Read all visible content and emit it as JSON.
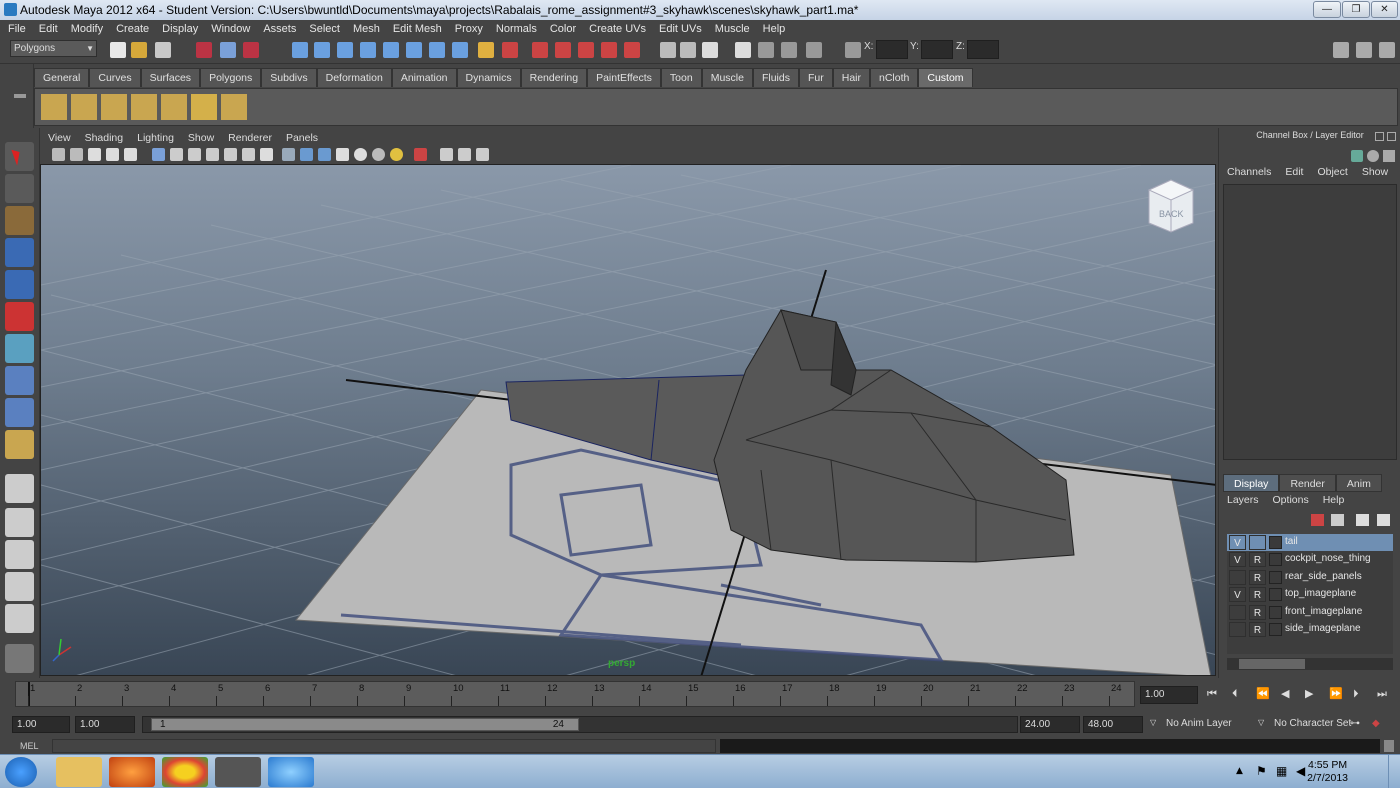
{
  "window": {
    "title": "Autodesk Maya 2012 x64 - Student Version: C:\\Users\\bwuntld\\Documents\\maya\\projects\\Rabalais_rome_assignment#3_skyhawk\\scenes\\skyhawk_part1.ma*",
    "minimize": "—",
    "maximize": "❐",
    "close": "✕"
  },
  "menubar": [
    "File",
    "Edit",
    "Modify",
    "Create",
    "Display",
    "Window",
    "Assets",
    "Select",
    "Mesh",
    "Edit Mesh",
    "Proxy",
    "Normals",
    "Color",
    "Create UVs",
    "Edit UVs",
    "Muscle",
    "Help"
  ],
  "statusline": {
    "menuset": "Polygons",
    "x_label": "X:",
    "y_label": "Y:",
    "z_label": "Z:"
  },
  "shelf": {
    "tabs": [
      "General",
      "Curves",
      "Surfaces",
      "Polygons",
      "Subdivs",
      "Deformation",
      "Animation",
      "Dynamics",
      "Rendering",
      "PaintEffects",
      "Toon",
      "Muscle",
      "Fluids",
      "Fur",
      "Hair",
      "nCloth",
      "Custom"
    ],
    "active_tab": "Custom"
  },
  "viewport": {
    "menu": [
      "View",
      "Shading",
      "Lighting",
      "Show",
      "Renderer",
      "Panels"
    ],
    "camera_label": "persp",
    "viewcube_face": "BACK"
  },
  "channelbox": {
    "title": "Channel Box / Layer Editor",
    "menu": [
      "Channels",
      "Edit",
      "Object",
      "Show"
    ]
  },
  "layer_editor": {
    "tabs": [
      "Display",
      "Render",
      "Anim"
    ],
    "active_tab": "Display",
    "menu": [
      "Layers",
      "Options",
      "Help"
    ],
    "layers": [
      {
        "v": "V",
        "r": "",
        "name": "tail",
        "selected": true
      },
      {
        "v": "V",
        "r": "R",
        "name": "cockpit_nose_thing",
        "selected": false
      },
      {
        "v": "",
        "r": "R",
        "name": "rear_side_panels",
        "selected": false
      },
      {
        "v": "V",
        "r": "R",
        "name": "top_imageplane",
        "selected": false
      },
      {
        "v": "",
        "r": "R",
        "name": "front_imageplane",
        "selected": false
      },
      {
        "v": "",
        "r": "R",
        "name": "side_imageplane",
        "selected": false
      }
    ]
  },
  "timeline": {
    "ticks": [
      "1",
      "2",
      "3",
      "4",
      "5",
      "6",
      "7",
      "8",
      "9",
      "10",
      "11",
      "12",
      "13",
      "14",
      "15",
      "16",
      "17",
      "18",
      "19",
      "20",
      "21",
      "22",
      "23",
      "24"
    ],
    "current_frame": "1.00"
  },
  "range": {
    "start": "1.00",
    "playback_start": "1.00",
    "slider_start": "1",
    "slider_end": "24",
    "playback_end": "24.00",
    "end": "48.00",
    "anim_layer": "No Anim Layer",
    "character_set": "No Character Set"
  },
  "mel": {
    "label": "MEL"
  },
  "taskbar": {
    "time": "4:55 PM",
    "date": "2/7/2013"
  },
  "colors": {
    "maya_bg": "#444444",
    "selection": "#6f8fb3",
    "viewport_top": "#8a98a9",
    "viewport_bottom": "#394655"
  }
}
